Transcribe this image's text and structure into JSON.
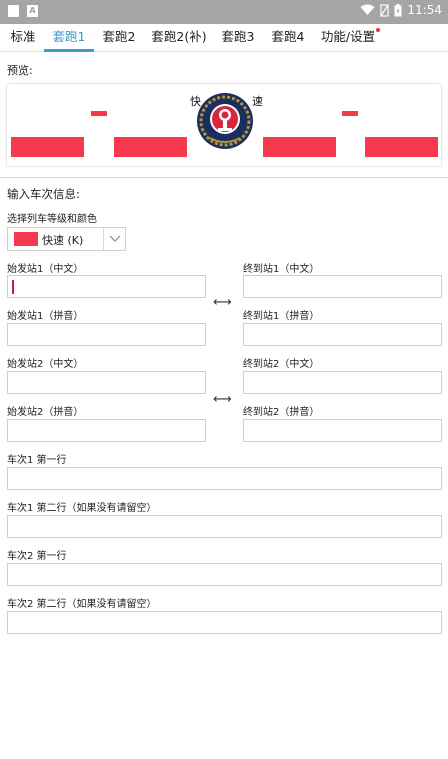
{
  "statusbar": {
    "time": "11:54",
    "notification_letter": "A"
  },
  "tabs": [
    {
      "label": "标准"
    },
    {
      "label": "套跑1",
      "active": true
    },
    {
      "label": "套跑2"
    },
    {
      "label": "套跑2(补)"
    },
    {
      "label": "套跑3"
    },
    {
      "label": "套跑4"
    },
    {
      "label": "功能/设置"
    }
  ],
  "preview": {
    "title": "预览:",
    "chars": [
      "快",
      "速"
    ],
    "bar_color": "#f53a4e"
  },
  "form": {
    "section_title": "输入车次信息:",
    "grade_label": "选择列车等级和颜色",
    "grade_value": "快速 (K)",
    "grade_color": "#f53a4e",
    "start1_cn": "始发站1（中文）",
    "end1_cn": "终到站1（中文）",
    "start1_py": "始发站1（拼音）",
    "end1_py": "终到站1（拼音）",
    "start2_cn": "始发站2（中文）",
    "end2_cn": "终到站2（中文）",
    "start2_py": "始发站2（拼音）",
    "end2_py": "终到站2（拼音）",
    "swap_symbol": "⟷",
    "train1_line1": "车次1 第一行",
    "train1_line2": "车次1 第二行（如果没有请留空）",
    "train2_line1": "车次2 第一行",
    "train2_line2": "车次2 第二行（如果没有请留空）"
  },
  "accent_color": "#3c9cc8"
}
